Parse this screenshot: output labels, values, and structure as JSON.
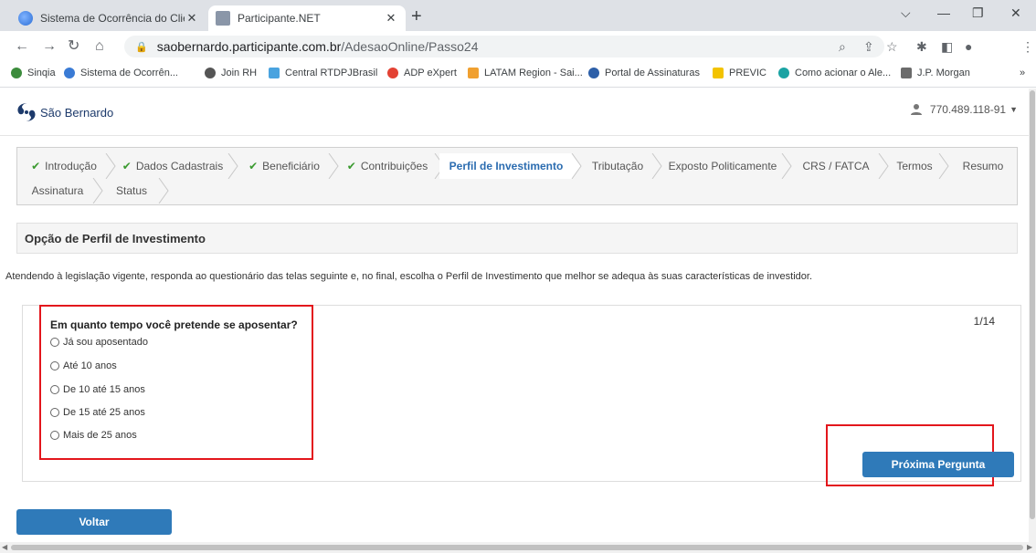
{
  "browser": {
    "tabs": [
      {
        "title": "Sistema de Ocorrência do Cliente",
        "active": false
      },
      {
        "title": "Participante.NET",
        "active": true
      }
    ],
    "url_host": "saobernardo.participante.com.br",
    "url_path": "/AdesaoOnline/Passo24",
    "bookmarks": [
      "Sinqia",
      "Sistema de Ocorrên...",
      "Join RH",
      "Central RTDPJBrasil",
      "ADP eXpert",
      "LATAM Region - Sai...",
      "Portal de Assinaturas",
      "PREVIC",
      "Como acionar o Ale...",
      "J.P. Morgan"
    ],
    "more_bookmarks": "»"
  },
  "header": {
    "logo_text": "São Bernardo",
    "user_id": "770.489.118-91"
  },
  "wizard": {
    "steps": [
      {
        "label": "Introdução",
        "done": true
      },
      {
        "label": "Dados Cadastrais",
        "done": true
      },
      {
        "label": "Beneficiário",
        "done": true
      },
      {
        "label": "Contribuições",
        "done": true
      },
      {
        "label": "Perfil de Investimento",
        "active": true
      },
      {
        "label": "Tributação"
      },
      {
        "label": "Exposto Politicamente"
      },
      {
        "label": "CRS / FATCA"
      },
      {
        "label": "Termos"
      },
      {
        "label": "Resumo"
      },
      {
        "label": "Assinatura"
      },
      {
        "label": "Status"
      }
    ],
    "check_glyph": "✔"
  },
  "section": {
    "title": "Opção de Perfil de Investimento",
    "intro": "Atendendo à legislação vigente, responda ao questionário das telas seguinte e, no final, escolha o Perfil de Investimento que melhor se adequa às suas características de investidor."
  },
  "question": {
    "counter": "1/14",
    "title": "Em quanto tempo você pretende se aposentar?",
    "options": [
      "Já sou aposentado",
      "Até 10 anos",
      "De 10 até 15 anos",
      "De 15 até 25 anos",
      "Mais de 25 anos"
    ],
    "next_label": "Próxima Pergunta"
  },
  "back_label": "Voltar",
  "colors": {
    "primary_button": "#2f7ab9",
    "highlight_red": "#e3161c",
    "check_green": "#3a9a2f",
    "active_step": "#2b6cb0"
  }
}
